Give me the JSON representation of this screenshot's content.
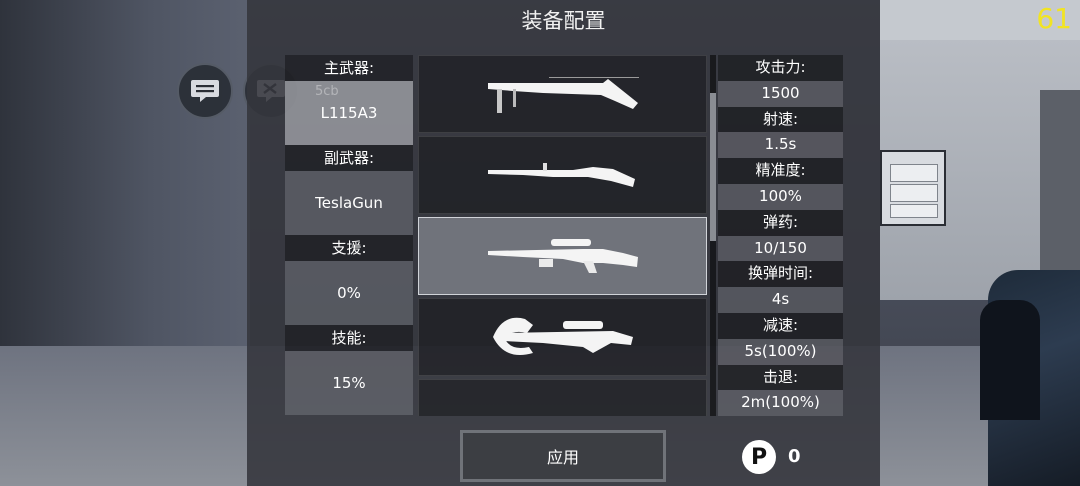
{
  "fps": "61",
  "title": "装备配置",
  "loadout": [
    {
      "label": "主武器:",
      "value": "L115A3",
      "ghost": "5cb"
    },
    {
      "label": "副武器:",
      "value": "TeslaGun"
    },
    {
      "label": "支援:",
      "value": "0%"
    },
    {
      "label": "技能:",
      "value": "15%"
    }
  ],
  "weapons": [
    {
      "icon": "shotgun-icon"
    },
    {
      "icon": "bolt-action-rifle-icon"
    },
    {
      "icon": "sniper-rifle-icon"
    },
    {
      "icon": "crossbow-icon"
    },
    {
      "icon": "rifle-icon"
    }
  ],
  "stats": [
    {
      "label": "攻击力:",
      "value": "1500"
    },
    {
      "label": "射速:",
      "value": "1.5s"
    },
    {
      "label": "精准度:",
      "value": "100%"
    },
    {
      "label": "弹药:",
      "value": "10/150"
    },
    {
      "label": "换弹时间:",
      "value": "4s"
    },
    {
      "label": "减速:",
      "value": "5s(100%)"
    },
    {
      "label": "击退:",
      "value": "2m(100%)"
    }
  ],
  "apply_label": "应用",
  "points": {
    "icon": "points-icon",
    "symbol": "P",
    "value": "0"
  },
  "colors": {
    "fps": "#f2e422",
    "panel": "#34363c"
  }
}
